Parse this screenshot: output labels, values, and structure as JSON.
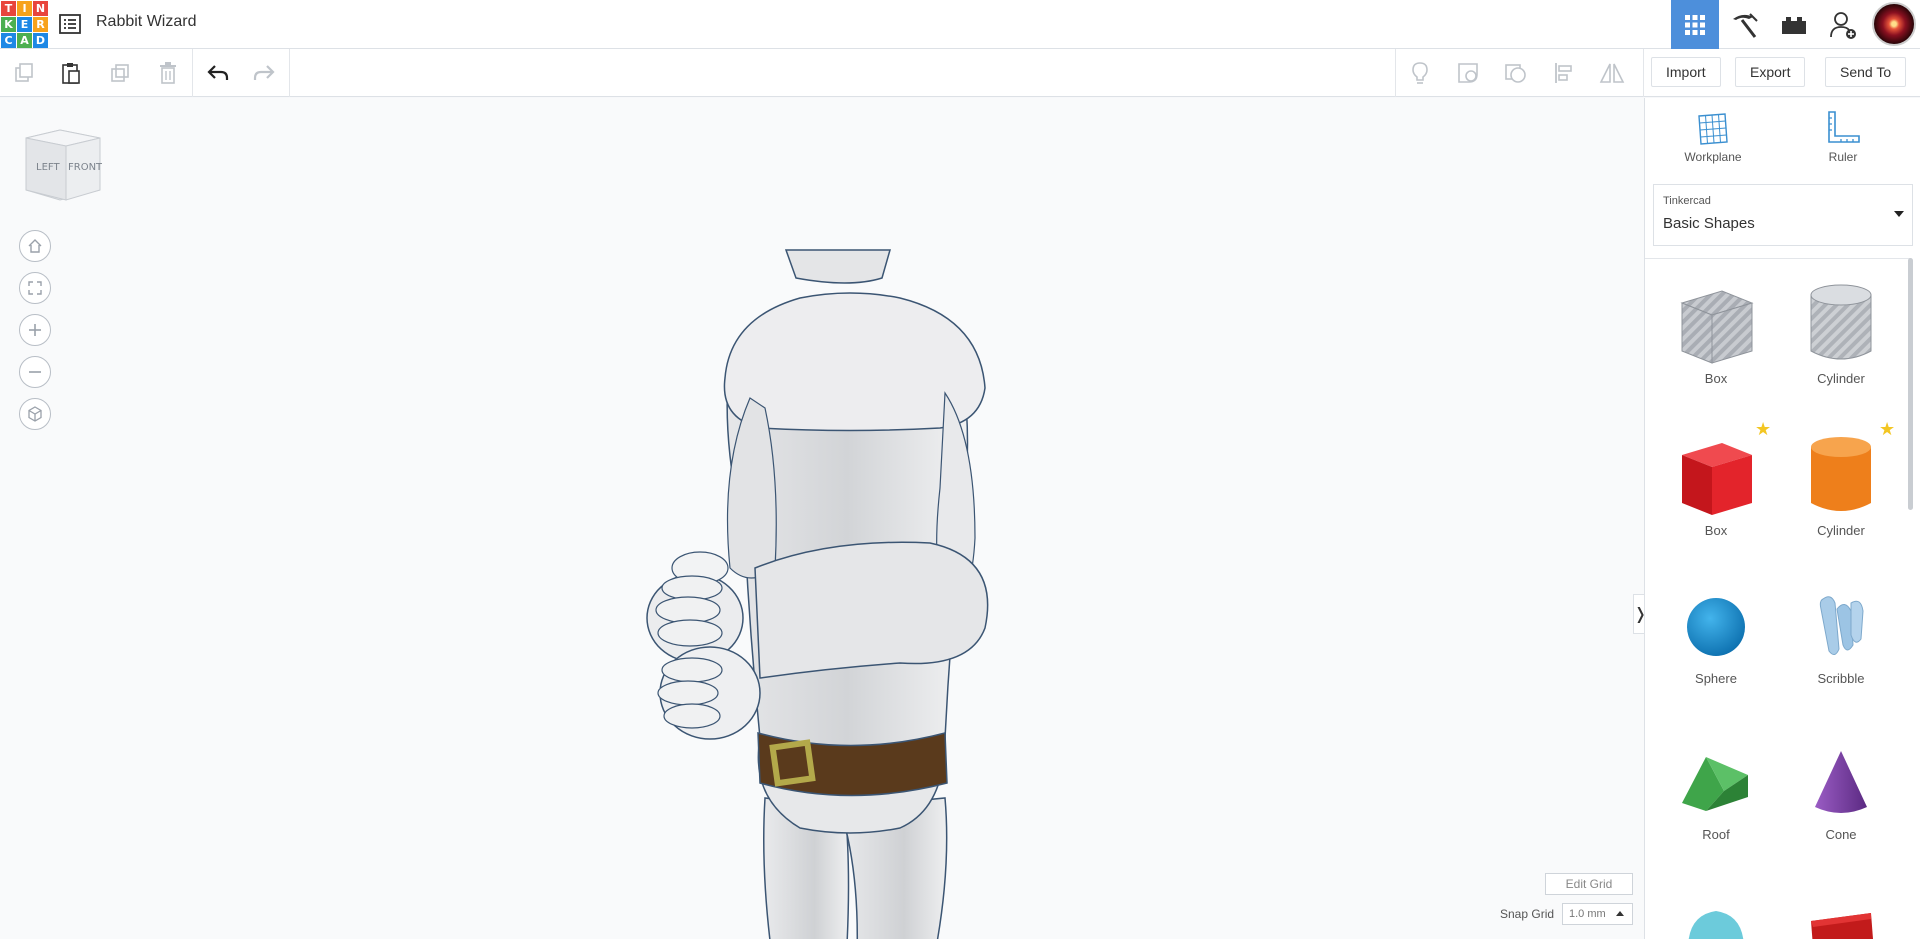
{
  "app": {
    "logo_letters": [
      "T",
      "I",
      "N",
      "K",
      "E",
      "R",
      "C",
      "A",
      "D"
    ],
    "logo_colors": [
      "#e8453c",
      "#f7a21b",
      "#e8453c",
      "#4caf50",
      "#1e88e5",
      "#f7a21b",
      "#1e88e5",
      "#4caf50",
      "#1e88e5"
    ],
    "design_title": "Rabbit Wizard",
    "accent_color": "#4d8fdb"
  },
  "header": {
    "modes": [
      {
        "name": "3d-design-view",
        "icon": "grid-icon",
        "active": true
      },
      {
        "name": "blocks-view",
        "icon": "pickaxe-icon",
        "active": false
      },
      {
        "name": "bricks-view",
        "icon": "brick-icon",
        "active": false
      },
      {
        "name": "add-user",
        "icon": "add-user-icon",
        "active": false
      }
    ]
  },
  "toolbar": {
    "left_tools": [
      "copy-icon",
      "paste-icon",
      "duplicate-icon",
      "trash-icon",
      "undo-icon",
      "redo-icon"
    ],
    "right_tools": [
      "light-bulb-icon",
      "note-icon",
      "group-icon",
      "align-icon",
      "mirror-icon"
    ],
    "import_label": "Import",
    "export_label": "Export",
    "send_to_label": "Send To"
  },
  "viewcube": {
    "left_label": "LEFT",
    "front_label": "FRONT"
  },
  "viewport": {
    "edit_grid_label": "Edit Grid",
    "snap_grid_label": "Snap Grid",
    "snap_grid_value": "1.0 mm",
    "nav": [
      "home-icon",
      "fit-icon",
      "zoom-in-icon",
      "zoom-out-icon",
      "perspective-icon"
    ]
  },
  "panel": {
    "workplane_label": "Workplane",
    "ruler_label": "Ruler",
    "library_source": "Tinkercad",
    "library_name": "Basic Shapes",
    "shapes": [
      {
        "label": "Box",
        "kind": "hole-box",
        "starred": false
      },
      {
        "label": "Cylinder",
        "kind": "hole-cylinder",
        "starred": false
      },
      {
        "label": "Box",
        "kind": "box",
        "starred": true,
        "color": "#e3242b"
      },
      {
        "label": "Cylinder",
        "kind": "cylinder",
        "starred": true,
        "color": "#ee7f1b"
      },
      {
        "label": "Sphere",
        "kind": "sphere",
        "starred": false,
        "color": "#1a8ed1"
      },
      {
        "label": "Scribble",
        "kind": "scribble",
        "starred": false,
        "color": "#9cc4e4"
      },
      {
        "label": "Roof",
        "kind": "roof",
        "starred": false,
        "color": "#3fa54a"
      },
      {
        "label": "Cone",
        "kind": "cone",
        "starred": false,
        "color": "#7a3ea0"
      }
    ]
  }
}
